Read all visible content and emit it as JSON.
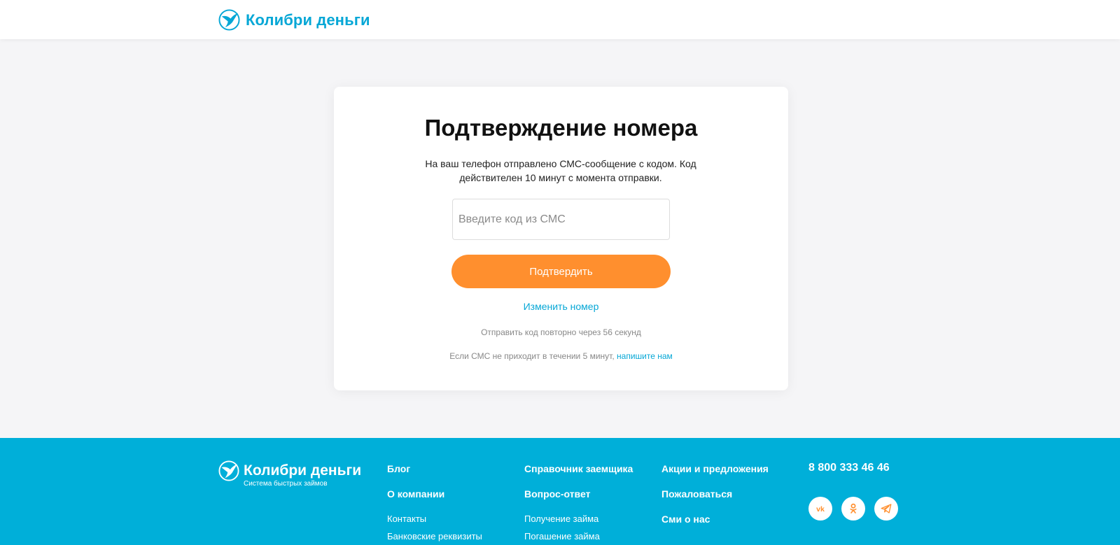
{
  "header": {
    "brand": "Колибри деньги"
  },
  "verify": {
    "title": "Подтверждение номера",
    "description": "На ваш телефон отправлено СМС-сообщение с кодом. Код действителен 10 минут с момента отправки.",
    "code_placeholder": "Введите код из СМС",
    "code_value": "",
    "confirm_label": "Подтвердить",
    "change_number_label": "Изменить номер",
    "resend_text": "Отправить код повторно через 56 секунд",
    "help_text": "Если СМС не приходит в течении 5 минут,",
    "help_link": "напишите нам"
  },
  "footer": {
    "brand": "Колибри деньги",
    "tagline": "Система быстрых займов",
    "col1": [
      "Блог",
      "О компании",
      "Контакты",
      "Банковские реквизиты"
    ],
    "col2": [
      "Справочник заемщика",
      "Вопрос-ответ",
      "Получение займа",
      "Погашение займа"
    ],
    "col3": [
      "Акции и предложения",
      "Пожаловаться",
      "Сми о нас"
    ],
    "phone": "8 800 333 46 46",
    "socials": [
      "vk-icon",
      "odnoklassniki-icon",
      "telegram-icon"
    ]
  },
  "colors": {
    "brand_blue": "#06a7d6",
    "footer_blue": "#00afd9",
    "accent_orange": "#ff8f2e"
  }
}
